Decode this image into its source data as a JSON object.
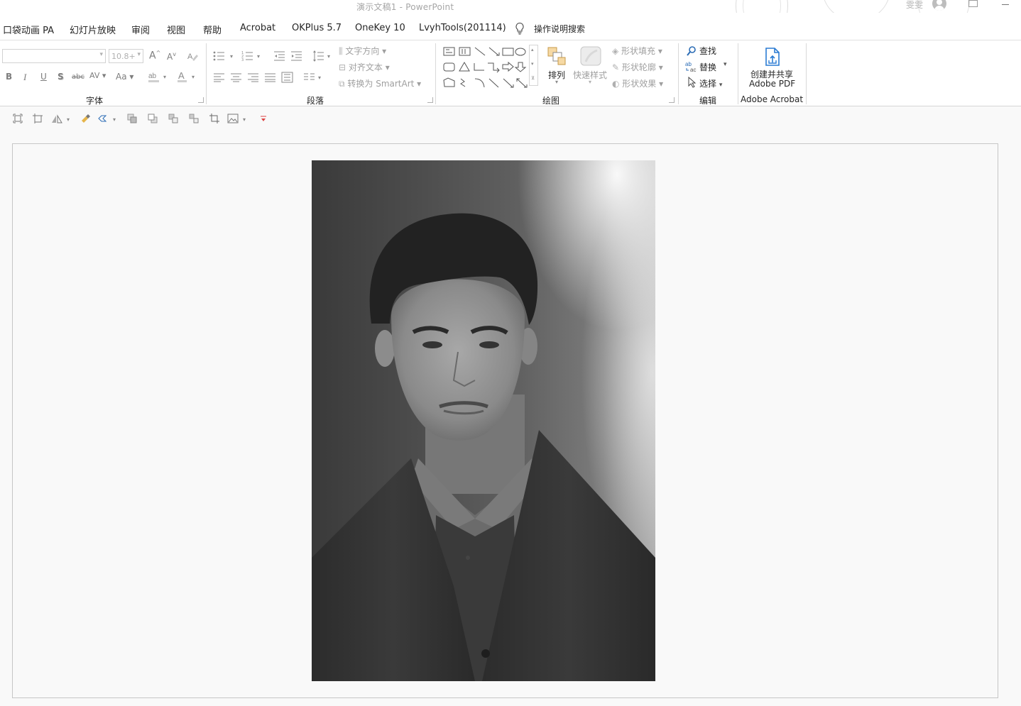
{
  "window": {
    "title": "演示文稿1  -  PowerPoint",
    "user": "雯雯"
  },
  "tabs": [
    {
      "label": "口袋动画 PA"
    },
    {
      "label": "幻灯片放映"
    },
    {
      "label": "审阅"
    },
    {
      "label": "视图"
    },
    {
      "label": "帮助"
    },
    {
      "label": "Acrobat"
    },
    {
      "label": "OKPlus 5.7"
    },
    {
      "label": "OneKey 10"
    },
    {
      "label": "LvyhTools(201114)"
    }
  ],
  "tell_me": {
    "label": "操作说明搜索"
  },
  "ribbon": {
    "font_group": {
      "label": "字体",
      "font_name": "",
      "font_size": "10.8+",
      "bold": "B",
      "italic": "I",
      "underline": "U",
      "shadow": "S",
      "strike": "abc",
      "spacing": "AV",
      "case": "Aa",
      "grow": "A",
      "shrink": "A",
      "color": "A"
    },
    "paragraph_group": {
      "label": "段落",
      "text_direction": "文字方向",
      "align_text": "对齐文本",
      "convert_smartart": "转换为 SmartArt"
    },
    "drawing_group": {
      "label": "绘图",
      "arrange": "排列",
      "quick_styles": "快速样式",
      "shape_fill": "形状填充",
      "shape_outline": "形状轮廓",
      "shape_effects": "形状效果"
    },
    "editing_group": {
      "label": "编辑",
      "find": "查找",
      "replace": "替换",
      "select": "选择"
    },
    "acrobat_group": {
      "label": "Adobe Acrobat",
      "create_share_line1": "创建并共享",
      "create_share_line2": "Adobe PDF"
    }
  },
  "colors": {
    "acrobat_blue": "#2b7cd3",
    "find_blue": "#2b6cb5"
  }
}
